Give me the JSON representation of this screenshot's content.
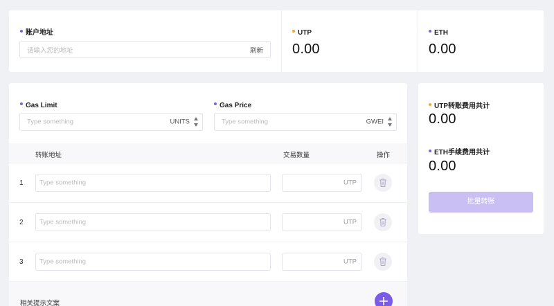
{
  "account": {
    "label": "账户地址",
    "placeholder": "请输入您的地址",
    "refresh_label": "刷新"
  },
  "balances": [
    {
      "label": "UTP",
      "value": "0.00",
      "dot_color": "#f5a623"
    },
    {
      "label": "ETH",
      "value": "0.00",
      "dot_color": "#7b61e0"
    }
  ],
  "gas": {
    "limit_label": "Gas Limit",
    "limit_placeholder": "Type something",
    "limit_unit": "UNITS",
    "price_label": "Gas Price",
    "price_placeholder": "Type something",
    "price_unit": "GWEI"
  },
  "table": {
    "headers": {
      "address": "转账地址",
      "amount": "交易数量",
      "action": "操作"
    },
    "rows": [
      {
        "index": "1",
        "address_placeholder": "Type something",
        "unit": "UTP"
      },
      {
        "index": "2",
        "address_placeholder": "Type something",
        "unit": "UTP"
      },
      {
        "index": "3",
        "address_placeholder": "Type something",
        "unit": "UTP"
      }
    ],
    "hint": "相关提示文案"
  },
  "summary": {
    "utp_fee_label": "UTP转账费用共计",
    "utp_fee_value": "0.00",
    "eth_fee_label": "ETH手续费用共计",
    "eth_fee_value": "0.00",
    "batch_button": "批量转账"
  },
  "colors": {
    "accent": "#7b5ce6",
    "accent_disabled": "#c9bff3",
    "orange": "#f5a623",
    "background": "#f0f1f4"
  }
}
